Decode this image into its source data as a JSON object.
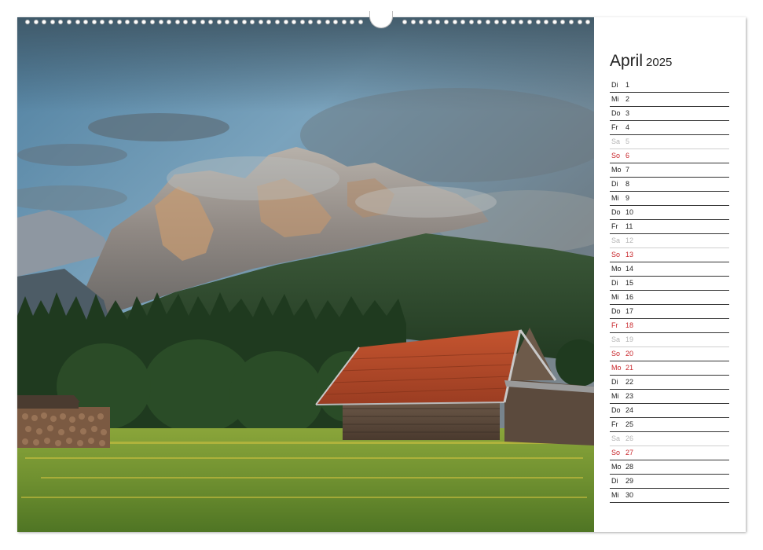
{
  "calendar": {
    "month": "April",
    "year": "2025",
    "days": [
      {
        "wd": "Di",
        "dn": "1",
        "kind": "normal"
      },
      {
        "wd": "Mi",
        "dn": "2",
        "kind": "normal"
      },
      {
        "wd": "Do",
        "dn": "3",
        "kind": "normal"
      },
      {
        "wd": "Fr",
        "dn": "4",
        "kind": "normal"
      },
      {
        "wd": "Sa",
        "dn": "5",
        "kind": "sat"
      },
      {
        "wd": "So",
        "dn": "6",
        "kind": "sun"
      },
      {
        "wd": "Mo",
        "dn": "7",
        "kind": "normal"
      },
      {
        "wd": "Di",
        "dn": "8",
        "kind": "normal"
      },
      {
        "wd": "Mi",
        "dn": "9",
        "kind": "normal"
      },
      {
        "wd": "Do",
        "dn": "10",
        "kind": "normal"
      },
      {
        "wd": "Fr",
        "dn": "11",
        "kind": "normal"
      },
      {
        "wd": "Sa",
        "dn": "12",
        "kind": "sat"
      },
      {
        "wd": "So",
        "dn": "13",
        "kind": "sun"
      },
      {
        "wd": "Mo",
        "dn": "14",
        "kind": "normal"
      },
      {
        "wd": "Di",
        "dn": "15",
        "kind": "normal"
      },
      {
        "wd": "Mi",
        "dn": "16",
        "kind": "normal"
      },
      {
        "wd": "Do",
        "dn": "17",
        "kind": "normal"
      },
      {
        "wd": "Fr",
        "dn": "18",
        "kind": "sun"
      },
      {
        "wd": "Sa",
        "dn": "19",
        "kind": "sat"
      },
      {
        "wd": "So",
        "dn": "20",
        "kind": "sun"
      },
      {
        "wd": "Mo",
        "dn": "21",
        "kind": "sun"
      },
      {
        "wd": "Di",
        "dn": "22",
        "kind": "normal"
      },
      {
        "wd": "Mi",
        "dn": "23",
        "kind": "normal"
      },
      {
        "wd": "Do",
        "dn": "24",
        "kind": "normal"
      },
      {
        "wd": "Fr",
        "dn": "25",
        "kind": "normal"
      },
      {
        "wd": "Sa",
        "dn": "26",
        "kind": "sat"
      },
      {
        "wd": "So",
        "dn": "27",
        "kind": "sun"
      },
      {
        "wd": "Mo",
        "dn": "28",
        "kind": "normal"
      },
      {
        "wd": "Di",
        "dn": "29",
        "kind": "normal"
      },
      {
        "wd": "Mi",
        "dn": "30",
        "kind": "normal"
      }
    ]
  },
  "colors": {
    "sunday_holiday": "#c8262b",
    "saturday": "#b5b5b5",
    "text": "#222222"
  }
}
